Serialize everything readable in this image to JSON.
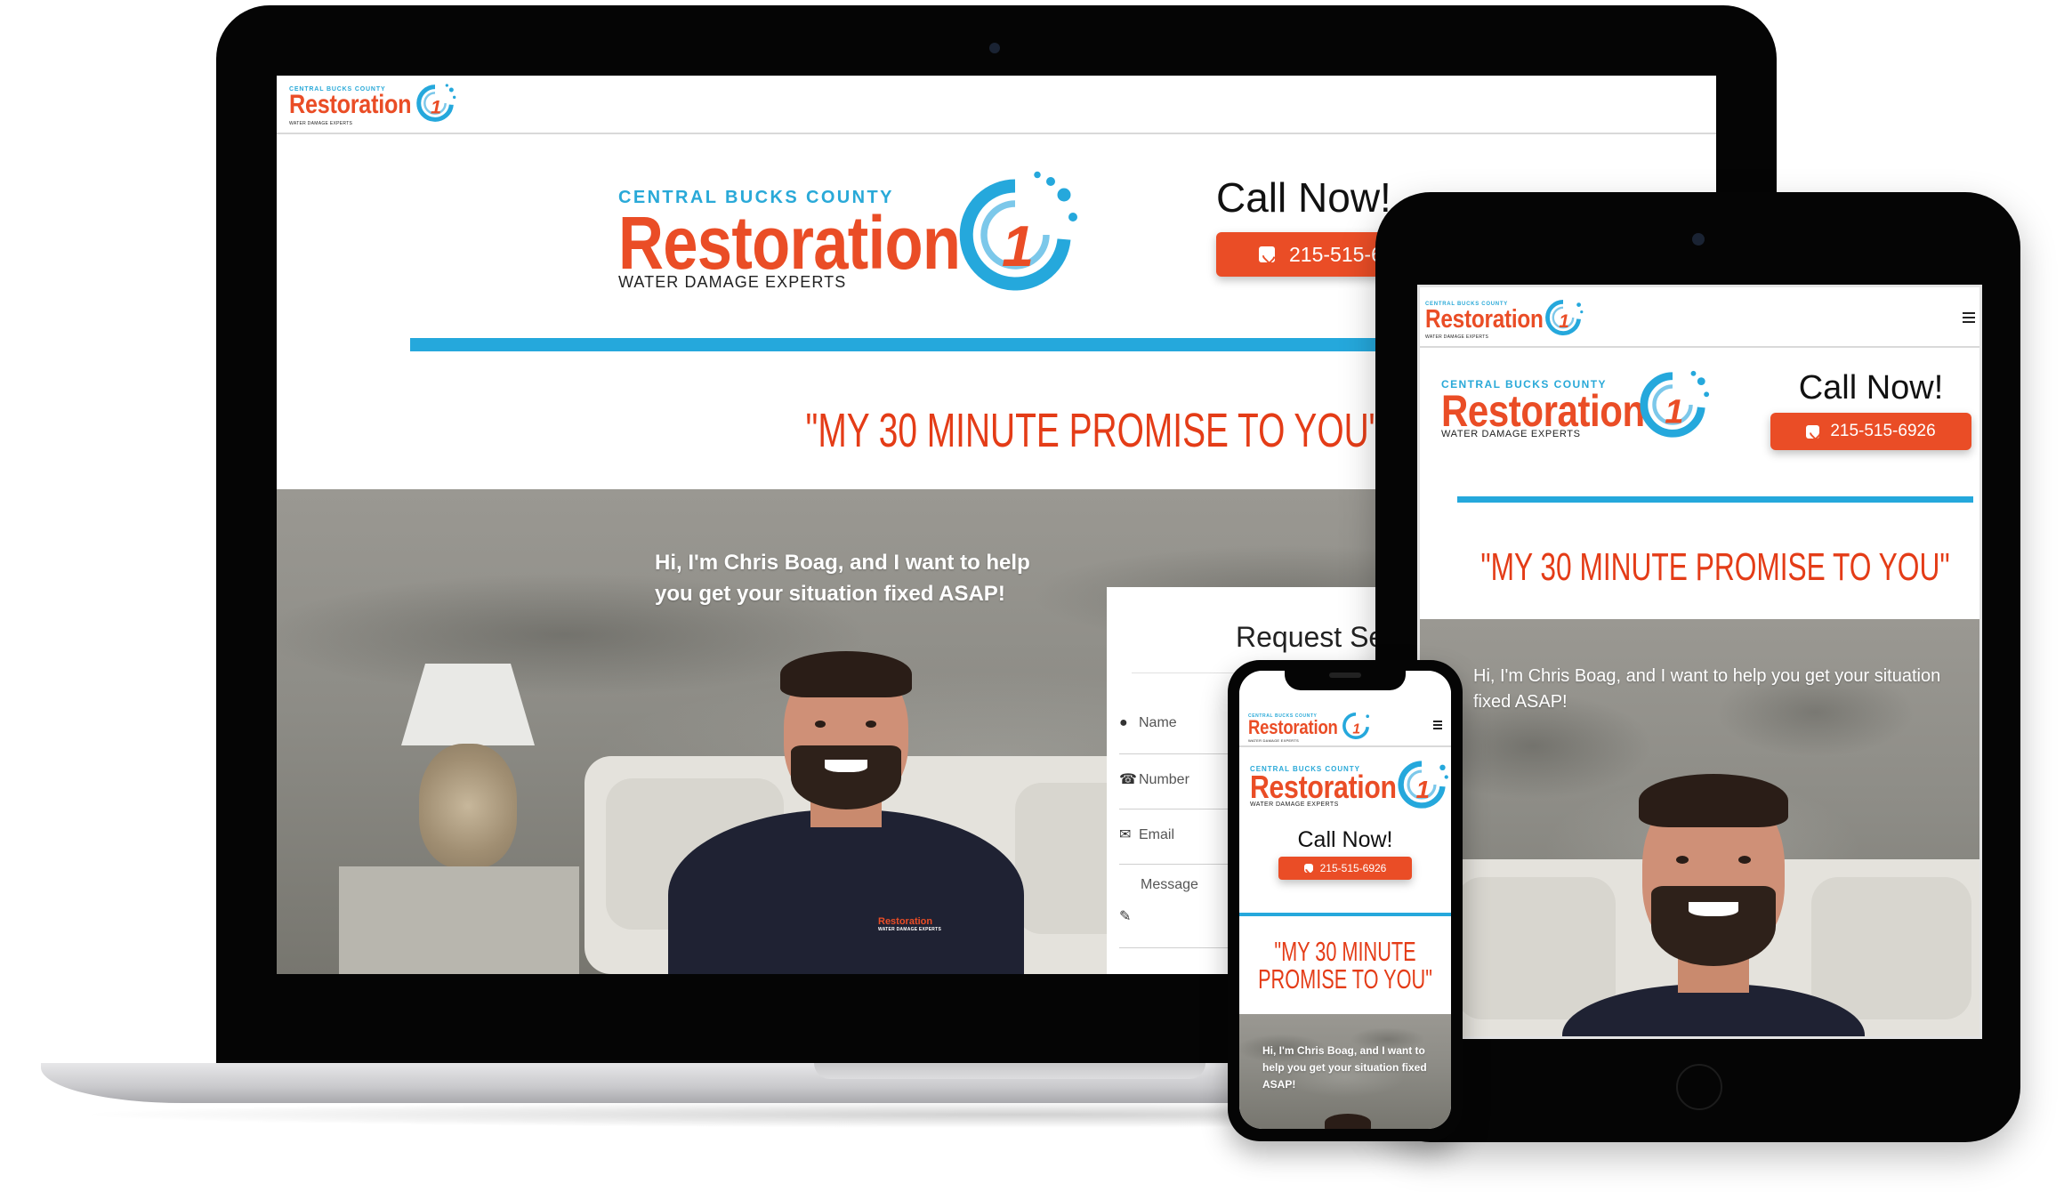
{
  "site": {
    "logo": {
      "line1": "CENTRAL BUCKS COUNTY",
      "line2": "Restoration",
      "number": "1",
      "line3": "WATER DAMAGE EXPERTS"
    },
    "call": {
      "title": "Call Now!",
      "phone": "215-515-6926",
      "phone_partial": "215-515-6"
    },
    "call_title_partial": "Call Now!",
    "promise": "\"MY 30 MINUTE PROMISE TO YOU\"",
    "promise_phone_line1": "\"MY 30 MINUTE",
    "promise_phone_line2": "PROMISE TO YOU\"",
    "hero_text": "Hi, I'm Chris Boag, and I want to help you get your situation fixed ASAP!",
    "hero_text_laptop_line1": "Hi, I'm Chris Boag, and I want to help",
    "hero_text_laptop_line2": "you get your situation fixed ASAP!",
    "shirt_logo": "Restoration",
    "shirt_logo_sub": "WATER DAMAGE EXPERTS",
    "form": {
      "title_partial": "Request Se",
      "fields": [
        {
          "icon": "user-icon",
          "placeholder": "Name"
        },
        {
          "icon": "phone-icon",
          "placeholder": "Number"
        },
        {
          "icon": "envelope-icon",
          "placeholder": "Email"
        },
        {
          "icon": "pencil-icon",
          "placeholder": "Message"
        }
      ]
    }
  },
  "colors": {
    "brand_orange": "#ea4d26",
    "brand_blue": "#25a8dc",
    "promise_red": "#e43c17"
  }
}
